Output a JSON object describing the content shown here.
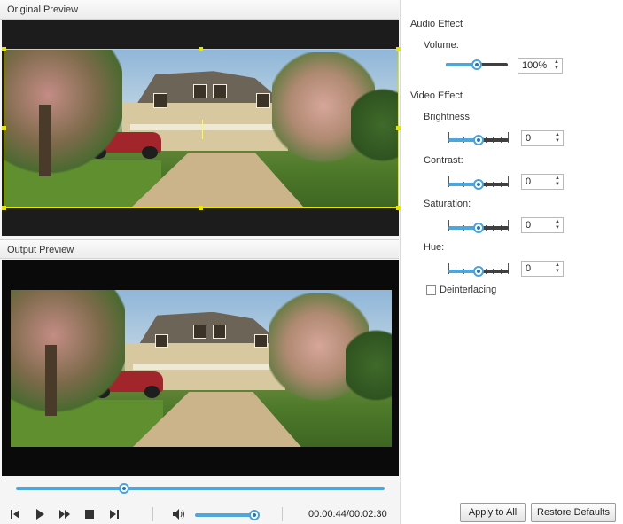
{
  "original_preview": {
    "title": "Original Preview"
  },
  "output_preview": {
    "title": "Output Preview"
  },
  "playback": {
    "progress": 0.293,
    "volume_level": 0.93,
    "time_display": "00:00:44/00:02:30",
    "icons": [
      "skip-back-icon",
      "play-icon",
      "fast-forward-icon",
      "stop-icon",
      "skip-forward-icon",
      "speaker-icon"
    ]
  },
  "audio_effect": {
    "title": "Audio Effect",
    "volume_label": "Volume:",
    "volume_value": "100%",
    "volume_level": 0.5
  },
  "video_effect": {
    "title": "Video Effect",
    "brightness_label": "Brightness:",
    "brightness_value": "0",
    "contrast_label": "Contrast:",
    "contrast_value": "0",
    "saturation_label": "Saturation:",
    "saturation_value": "0",
    "hue_label": "Hue:",
    "hue_value": "0",
    "deinterlacing_label": "Deinterlacing",
    "deinterlacing_checked": false
  },
  "buttons": {
    "apply_to_all": "Apply to All",
    "restore_defaults": "Restore Defaults"
  },
  "colors": {
    "accent": "#4da6dc",
    "crop_frame": "#e6e600"
  }
}
